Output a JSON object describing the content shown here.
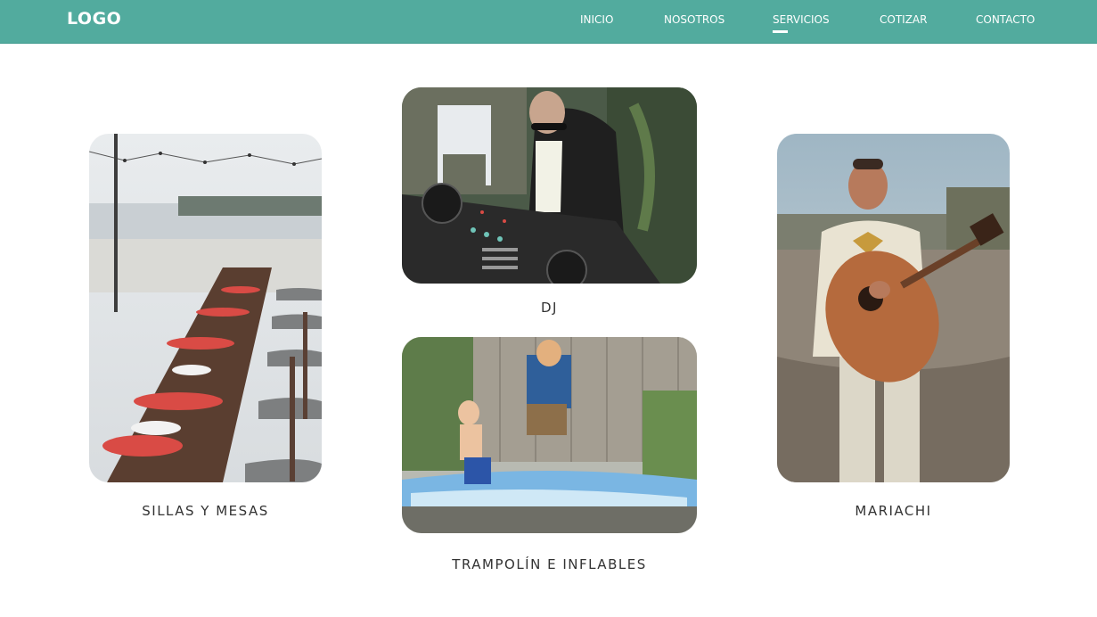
{
  "brand": {
    "logo": "LOGO"
  },
  "nav": {
    "items": [
      {
        "label": "INICIO"
      },
      {
        "label": "NOSOTROS"
      },
      {
        "label": "SERVICIOS",
        "active": true
      },
      {
        "label": "COTIZAR"
      },
      {
        "label": "CONTACTO"
      }
    ]
  },
  "services": [
    {
      "caption": "SILLAS Y MESAS",
      "image": "table-setting-photo"
    },
    {
      "caption": "DJ",
      "image": "dj-mixer-photo"
    },
    {
      "caption": "TRAMPOLÍN E INFLABLES",
      "image": "kids-inflatable-photo"
    },
    {
      "caption": "MARIACHI",
      "image": "mariachi-guitar-photo"
    }
  ],
  "colors": {
    "accent": "#52ab9e",
    "text": "#333333",
    "background": "#ffffff"
  }
}
